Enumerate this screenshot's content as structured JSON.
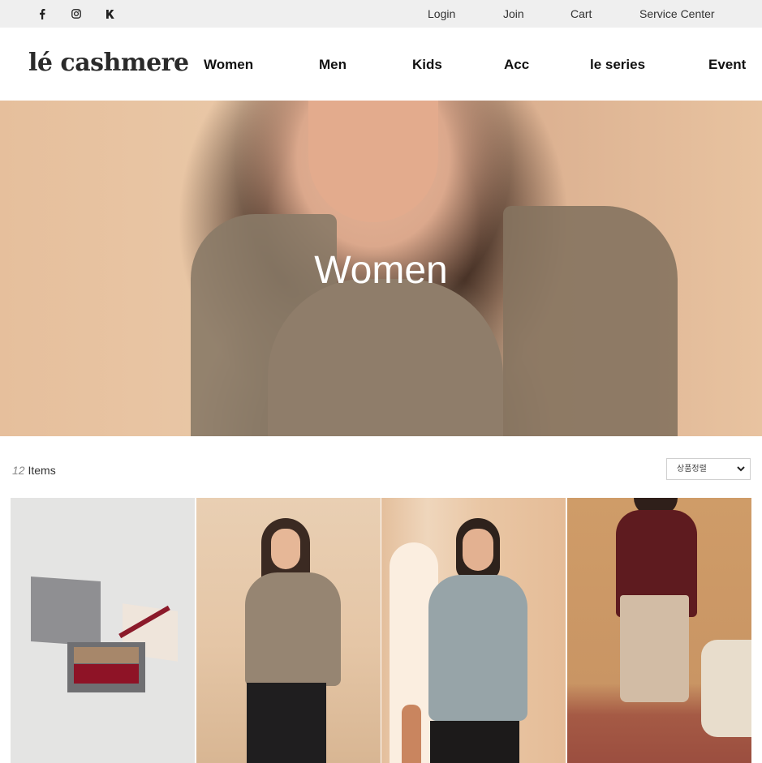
{
  "social": [
    {
      "name": "facebook-icon"
    },
    {
      "name": "instagram-icon"
    },
    {
      "name": "kakao-icon"
    }
  ],
  "util_nav": [
    {
      "label": "Login"
    },
    {
      "label": "Join"
    },
    {
      "label": "Cart"
    },
    {
      "label": "Service Center"
    }
  ],
  "brand": {
    "logo_text": "lé cashmere"
  },
  "main_nav": [
    {
      "label": "Women"
    },
    {
      "label": "Men"
    },
    {
      "label": "Kids"
    },
    {
      "label": "Acc"
    },
    {
      "label": "le series"
    },
    {
      "label": "Event"
    }
  ],
  "hero": {
    "title": "Women"
  },
  "listing": {
    "count": "12",
    "count_suffix": " Items",
    "sort": {
      "selected": "상품정렬"
    }
  },
  "products": [
    {
      "name": "product-gift-set"
    },
    {
      "name": "product-camel-sweater"
    },
    {
      "name": "product-grey-turtleneck"
    },
    {
      "name": "product-burgundy-sweater"
    }
  ],
  "colors": {
    "topbar": "#efefef",
    "text": "#333333",
    "logo": "#2a2a2a"
  }
}
